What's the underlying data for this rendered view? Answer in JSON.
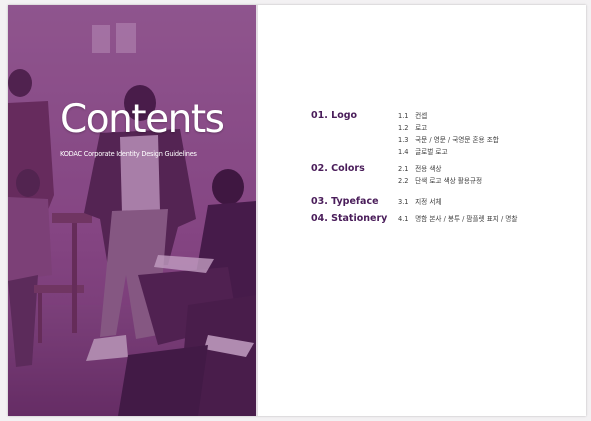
{
  "cover": {
    "title": "Contents",
    "subtitle": "KODAC Corporate Identity Design Guidelines",
    "overlay_color": "#7a3e77",
    "photo_description_icon": "classroom-photo"
  },
  "toc": {
    "sections": [
      {
        "heading": "01. Logo",
        "items": [
          {
            "num": "1.1",
            "label": "컨셉"
          },
          {
            "num": "1.2",
            "label": "로고"
          },
          {
            "num": "1.3",
            "label": "국문 / 영문 / 국영문 혼용 조합"
          },
          {
            "num": "1.4",
            "label": "글로벌 로고"
          }
        ]
      },
      {
        "heading": "02. Colors",
        "items": [
          {
            "num": "2.1",
            "label": "전용 색상"
          },
          {
            "num": "2.2",
            "label": "단색 로고 색상 활용규정"
          }
        ]
      },
      {
        "heading": "03. Typeface",
        "items": [
          {
            "num": "3.1",
            "label": "지정 서체"
          }
        ]
      },
      {
        "heading": "04. Stationery",
        "items": [
          {
            "num": "4.1",
            "label": "명함 본사 / 봉투 / 팜플렛 표지 / 명찰"
          }
        ]
      }
    ],
    "heading_color": "#4a1d5a"
  }
}
